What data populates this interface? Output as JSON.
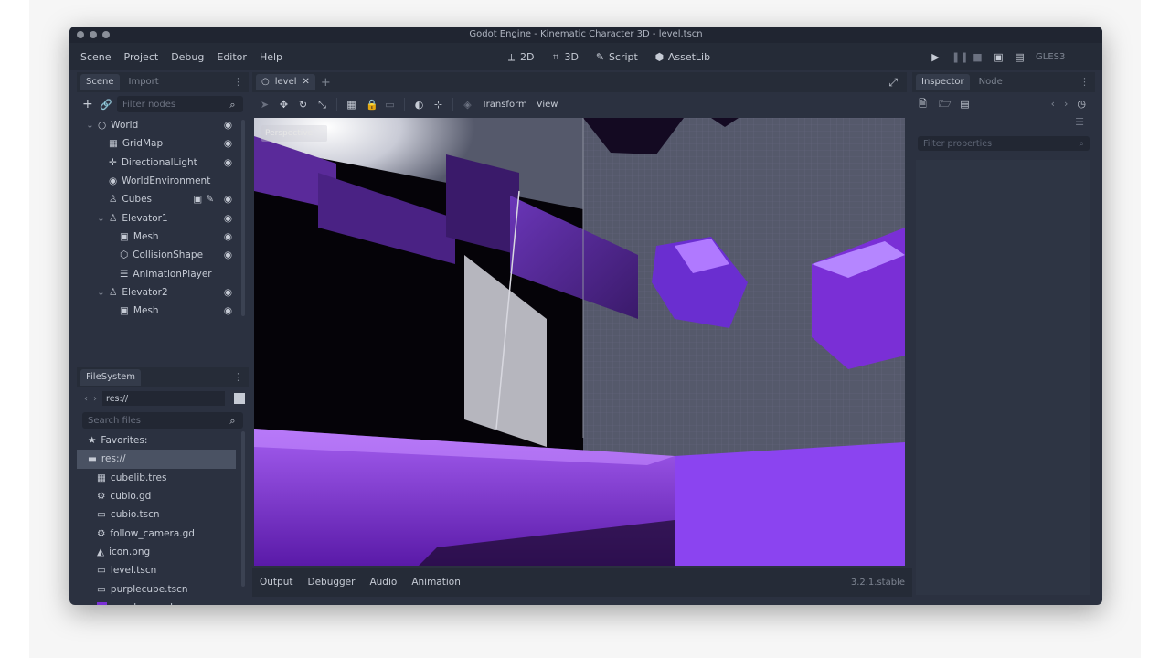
{
  "window": {
    "title": "Godot Engine - Kinematic Character 3D - level.tscn"
  },
  "menu": [
    "Scene",
    "Project",
    "Debug",
    "Editor",
    "Help"
  ],
  "modes": [
    {
      "icon": "2d-icon",
      "label": "2D"
    },
    {
      "icon": "3d-icon",
      "label": "3D"
    },
    {
      "icon": "script-icon",
      "label": "Script"
    },
    {
      "icon": "assetlib-icon",
      "label": "AssetLib"
    }
  ],
  "renderer": "GLES3",
  "scene_dock": {
    "tabs": [
      "Scene",
      "Import"
    ],
    "filter_placeholder": "Filter nodes",
    "nodes": [
      {
        "label": "World",
        "icon": "node3d-icon",
        "indent": 0,
        "expander": "⌄",
        "visible": true
      },
      {
        "label": "GridMap",
        "icon": "gridmap-icon",
        "indent": 1,
        "expander": "",
        "visible": true
      },
      {
        "label": "DirectionalLight",
        "icon": "light-icon",
        "indent": 1,
        "expander": "",
        "visible": true
      },
      {
        "label": "WorldEnvironment",
        "icon": "environment-icon",
        "indent": 1,
        "expander": "",
        "visible": false
      },
      {
        "label": "Cubes",
        "icon": "spatial-icon",
        "indent": 1,
        "expander": "",
        "visible": true,
        "extra": true
      },
      {
        "label": "Elevator1",
        "icon": "kinematic-icon",
        "indent": 1,
        "expander": "⌄",
        "visible": true
      },
      {
        "label": "Mesh",
        "icon": "mesh-icon",
        "indent": 2,
        "expander": "",
        "visible": true
      },
      {
        "label": "CollisionShape",
        "icon": "collision-icon",
        "indent": 2,
        "expander": "",
        "visible": true
      },
      {
        "label": "AnimationPlayer",
        "icon": "animation-icon",
        "indent": 2,
        "expander": "",
        "visible": false
      },
      {
        "label": "Elevator2",
        "icon": "kinematic-icon",
        "indent": 1,
        "expander": "⌄",
        "visible": true
      },
      {
        "label": "Mesh",
        "icon": "mesh-icon",
        "indent": 2,
        "expander": "",
        "visible": true
      }
    ]
  },
  "filesystem": {
    "tab": "FileSystem",
    "path": "res://",
    "search_placeholder": "Search files",
    "items": [
      {
        "label": "Favorites:",
        "icon": "star-icon",
        "indent": 0,
        "selected": false
      },
      {
        "label": "res://",
        "icon": "folder-icon",
        "indent": 0,
        "selected": true
      },
      {
        "label": "cubelib.tres",
        "icon": "resource-icon",
        "indent": 1,
        "selected": false
      },
      {
        "label": "cubio.gd",
        "icon": "gear-icon",
        "indent": 1,
        "selected": false
      },
      {
        "label": "cubio.tscn",
        "icon": "scene-icon",
        "indent": 1,
        "selected": false
      },
      {
        "label": "follow_camera.gd",
        "icon": "gear-icon",
        "indent": 1,
        "selected": false
      },
      {
        "label": "icon.png",
        "icon": "image-icon",
        "indent": 1,
        "selected": false
      },
      {
        "label": "level.tscn",
        "icon": "scene-icon",
        "indent": 1,
        "selected": false
      },
      {
        "label": "purplecube.tscn",
        "icon": "scene-icon",
        "indent": 1,
        "selected": false
      },
      {
        "label": "purple_wood.png",
        "icon": "image-swatch-icon",
        "indent": 1,
        "selected": false
      }
    ]
  },
  "scene_tab": {
    "label": "level"
  },
  "toolbar_3d": {
    "transform": "Transform",
    "view": "View"
  },
  "viewport": {
    "label": "Perspective"
  },
  "bottom_tabs": [
    "Output",
    "Debugger",
    "Audio",
    "Animation"
  ],
  "version": "3.2.1.stable",
  "inspector": {
    "tabs": [
      "Inspector",
      "Node"
    ],
    "filter_placeholder": "Filter properties"
  },
  "colors": {
    "accent": "#7a2fd6",
    "panel": "#2b3140",
    "selection": "#4a5263"
  }
}
